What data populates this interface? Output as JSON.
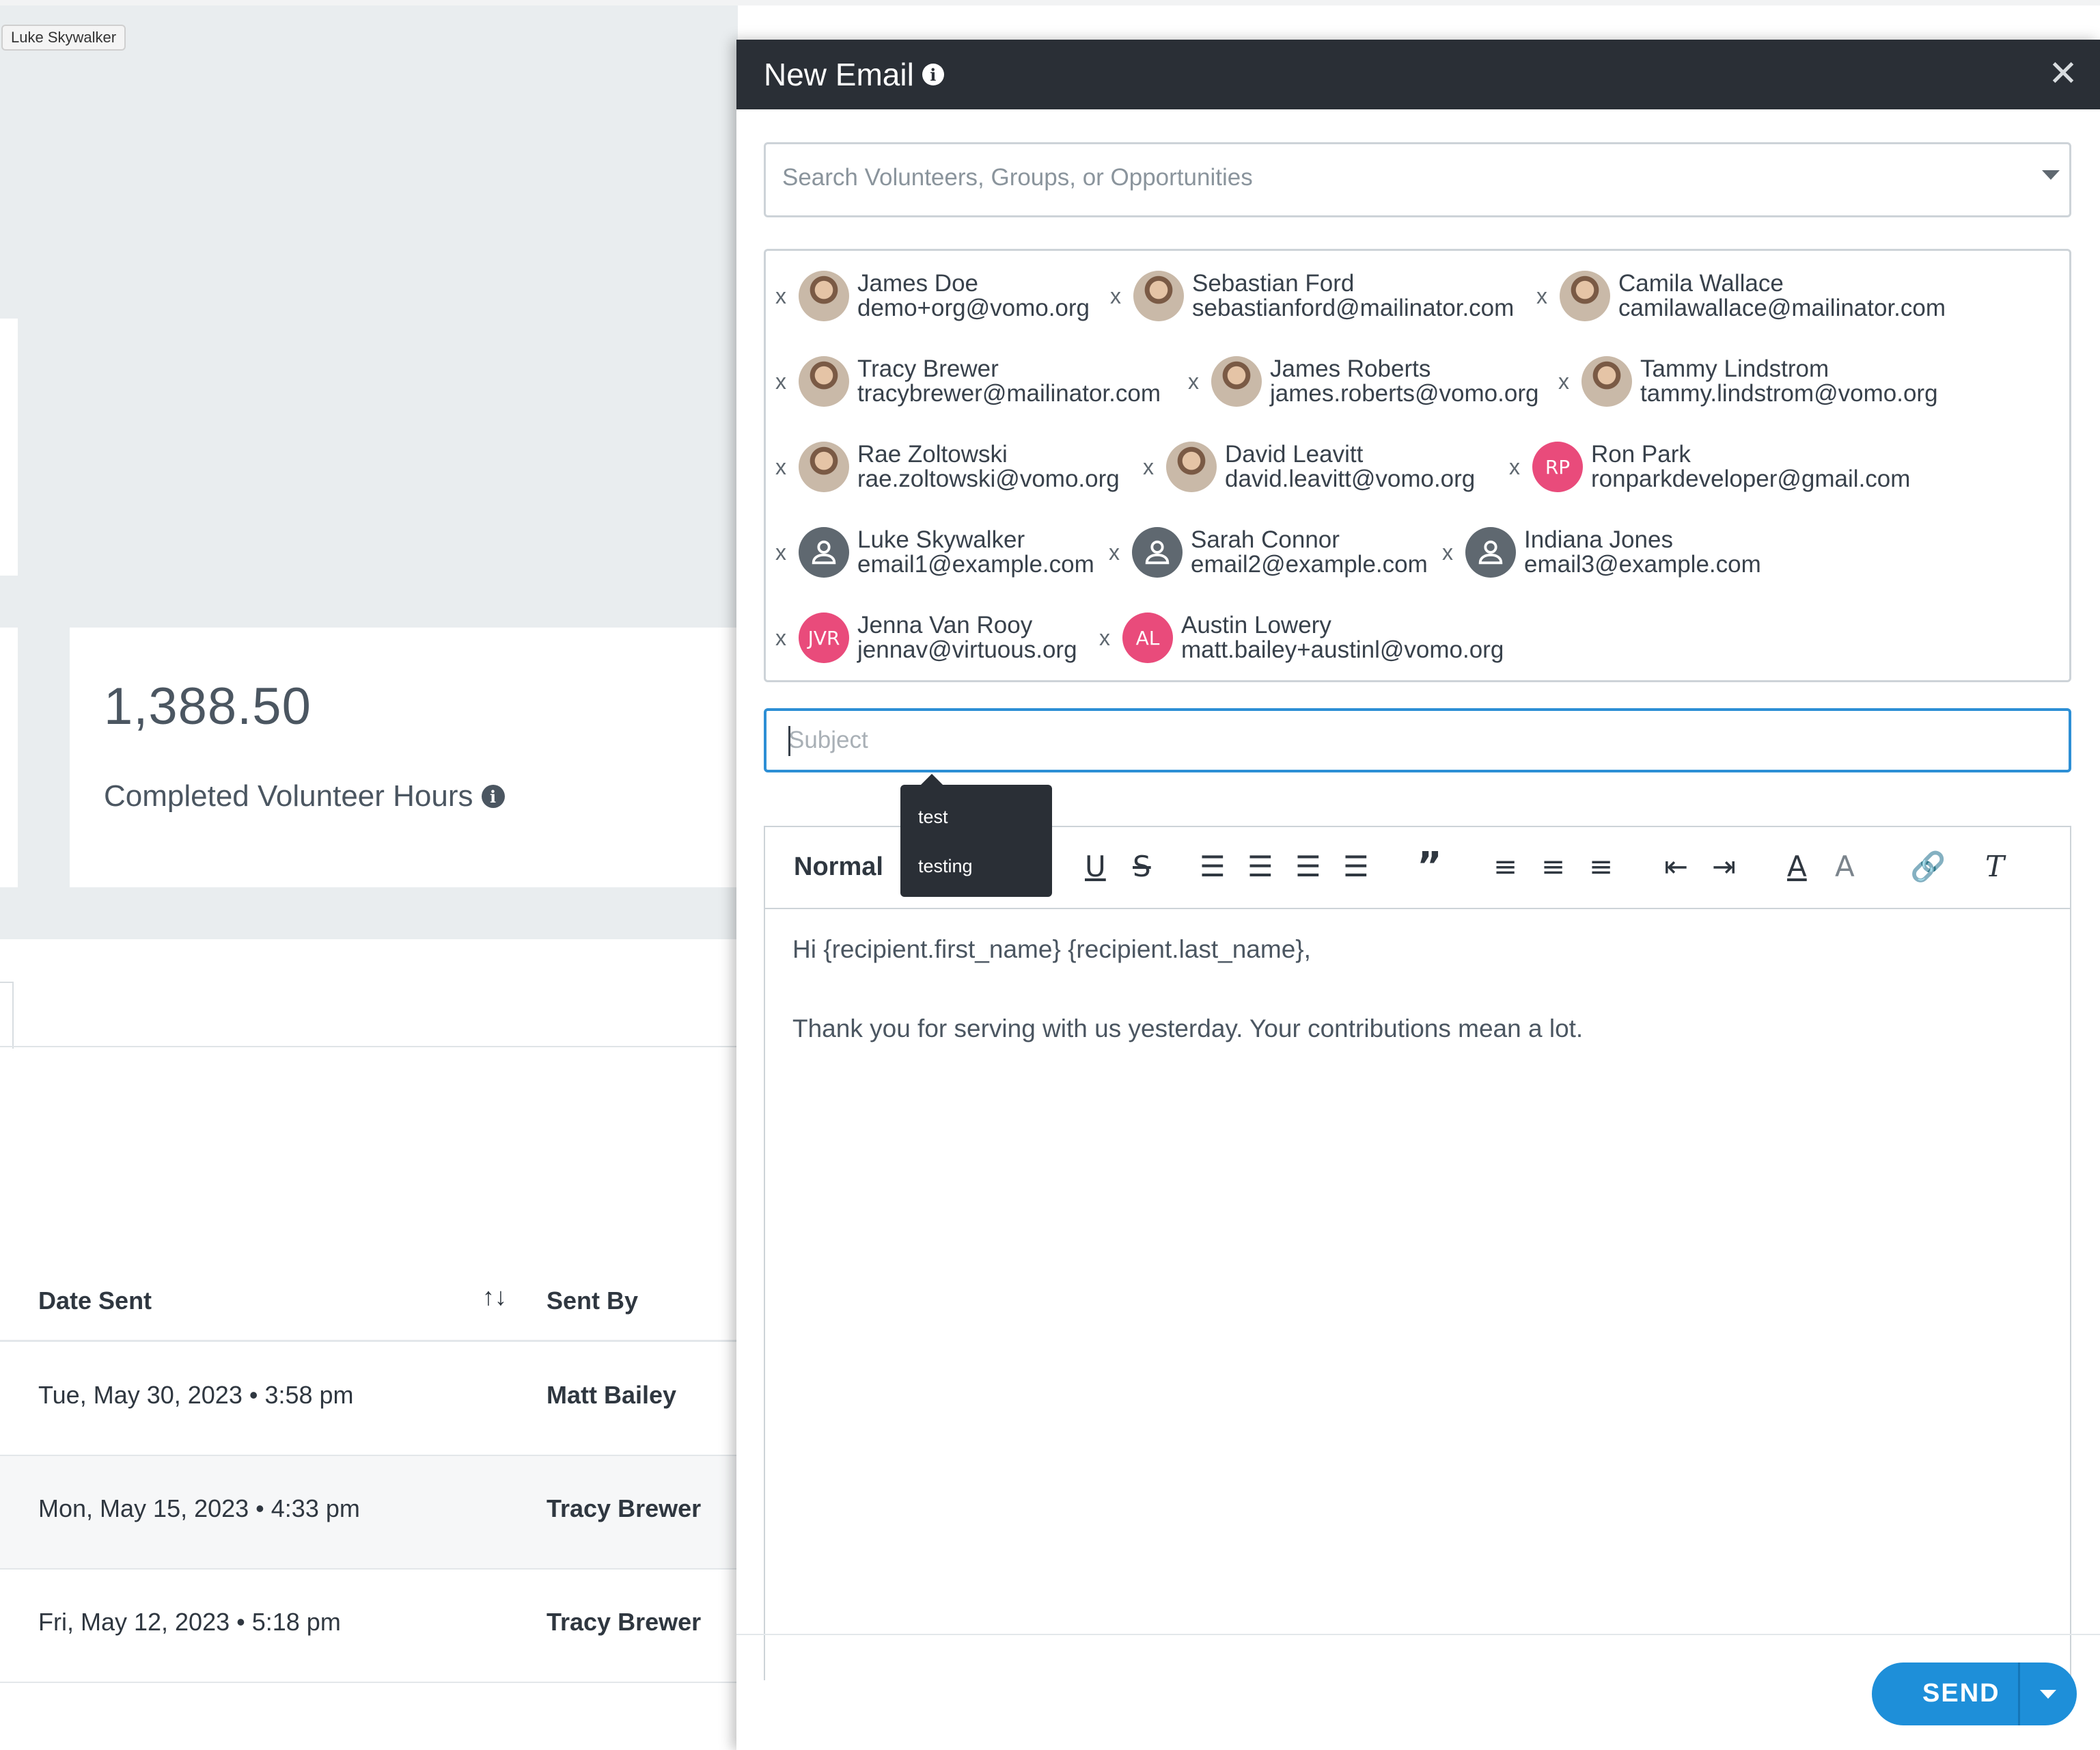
{
  "background": {
    "user_tooltip": "Luke Skywalker",
    "stat": {
      "value": "1,388.50",
      "label": "Completed Volunteer Hours"
    },
    "table": {
      "columns": [
        "Date Sent",
        "Sent By"
      ],
      "rows": [
        {
          "date": "Tue, May 30, 2023 • 3:58 pm",
          "sent_by": "Matt Bailey"
        },
        {
          "date": "Mon, May 15, 2023 • 4:33 pm",
          "sent_by": "Tracy Brewer"
        },
        {
          "date": "Fri, May 12, 2023 • 5:18 pm",
          "sent_by": "Tracy Brewer"
        }
      ]
    }
  },
  "modal": {
    "title": "New Email",
    "search_placeholder": "Search Volunteers, Groups, or Opportunities",
    "remove_label": "x",
    "recipients": [
      {
        "name": "James Doe",
        "email": "demo+org@vomo.org",
        "avatar": "photo"
      },
      {
        "name": "Sebastian Ford",
        "email": "sebastianford@mailinator.com",
        "avatar": "photo"
      },
      {
        "name": "Camila Wallace",
        "email": "camilawallace@mailinator.com",
        "avatar": "photo"
      },
      {
        "name": "Tracy Brewer",
        "email": "tracybrewer@mailinator.com",
        "avatar": "photo"
      },
      {
        "name": "James Roberts",
        "email": "james.roberts@vomo.org",
        "avatar": "photo"
      },
      {
        "name": "Tammy Lindstrom",
        "email": "tammy.lindstrom@vomo.org",
        "avatar": "photo"
      },
      {
        "name": "Rae Zoltowski",
        "email": "rae.zoltowski@vomo.org",
        "avatar": "photo"
      },
      {
        "name": "David Leavitt",
        "email": "david.leavitt@vomo.org",
        "avatar": "photo"
      },
      {
        "name": "Ron Park",
        "email": "ronparkdeveloper@gmail.com",
        "avatar": "initials",
        "initials": "RP"
      },
      {
        "name": "Luke Skywalker",
        "email": "email1@example.com",
        "avatar": "generic-user-icon"
      },
      {
        "name": "Sarah Connor",
        "email": "email2@example.com",
        "avatar": "generic-user-icon"
      },
      {
        "name": "Indiana Jones",
        "email": "email3@example.com",
        "avatar": "generic-user-icon"
      },
      {
        "name": "Jenna Van Rooy",
        "email": "jennav@virtuous.org",
        "avatar": "initials",
        "initials": "JVR"
      },
      {
        "name": "Austin Lowery",
        "email": "matt.bailey+austinl@vomo.org",
        "avatar": "initials",
        "initials": "AL"
      }
    ],
    "subject_placeholder": "Subject",
    "subject_suggestions": [
      "test",
      "testing"
    ],
    "toolbar": {
      "format_label": "Normal",
      "buttons": [
        "italic",
        "underline",
        "strikethrough",
        "align-left",
        "align-center",
        "align-right",
        "justify",
        "blockquote",
        "ordered-list",
        "bullet-list",
        "check-list",
        "outdent",
        "indent",
        "text-color",
        "background-color",
        "link",
        "clear-formatting"
      ]
    },
    "body": {
      "line1": "Hi {recipient.first_name} {recipient.last_name},",
      "line2": "Thank you for serving with us yesterday. Your contributions mean a lot."
    },
    "send_label": "SEND"
  },
  "colors": {
    "header_bg": "#2a2f36",
    "accent_blue": "#1e8fd9",
    "initials_pink": "#e94b7b",
    "page_gray": "#e9edef"
  }
}
